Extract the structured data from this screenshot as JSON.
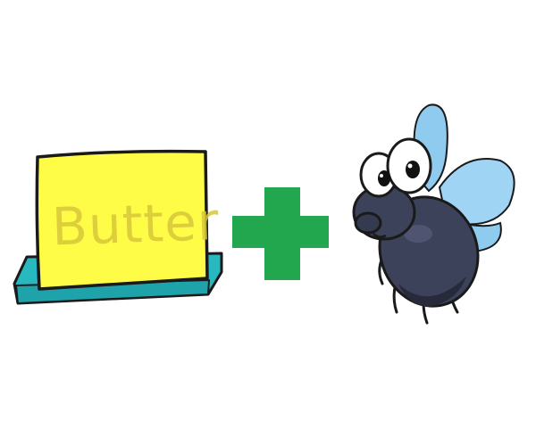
{
  "butter": {
    "label": "Butter",
    "block_color": "#fefc47",
    "block_outline": "#1a1a1a",
    "label_color": "#d8c83a",
    "dish_color": "#28b8bf",
    "dish_dark": "#0f7f86"
  },
  "operator": {
    "symbol": "plus-icon",
    "color": "#23a74e"
  },
  "fly": {
    "body_color": "#3c4259",
    "body_shade": "#262a3a",
    "wing_color": "#8fcbef",
    "eye_white": "#ffffff",
    "pupil_color": "#111111"
  }
}
